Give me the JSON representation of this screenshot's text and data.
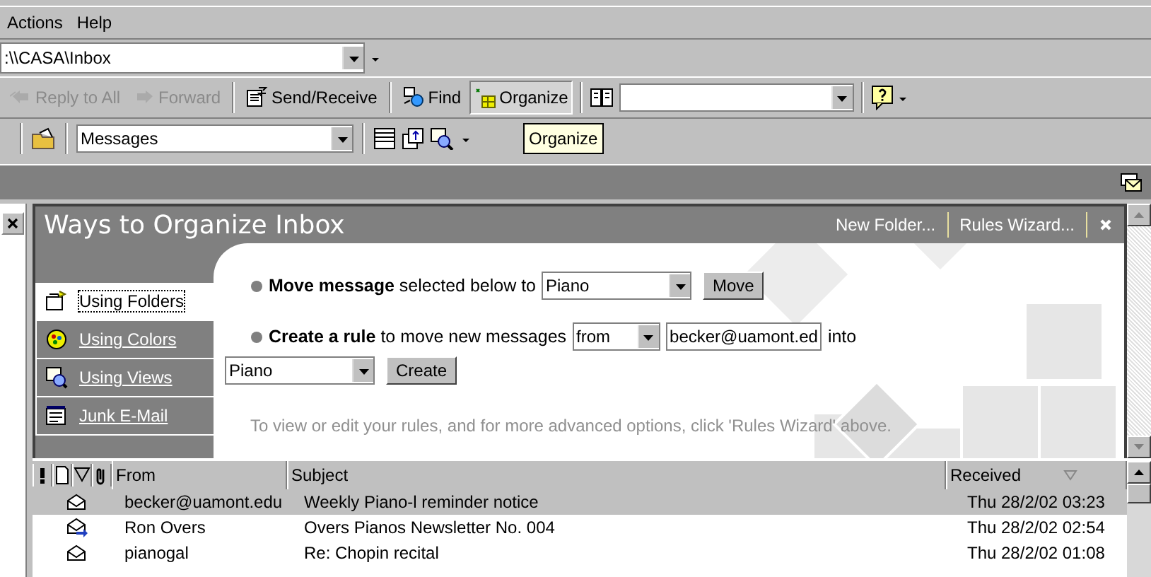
{
  "menu": [
    {
      "label": "Actions"
    },
    {
      "label": "Help"
    }
  ],
  "address": {
    "value": ":\\\\CASA\\Inbox"
  },
  "toolbar": [
    {
      "kind": "reply-all",
      "label": "Reply to All",
      "disabled": true,
      "pressed": false
    },
    {
      "kind": "forward",
      "label": "Forward",
      "disabled": true,
      "pressed": false
    },
    {
      "kind": "send-receive",
      "label": "Send/Receive",
      "disabled": false,
      "pressed": false
    },
    {
      "kind": "find",
      "label": "Find",
      "disabled": false,
      "pressed": false
    },
    {
      "kind": "organize",
      "label": "Organize",
      "disabled": false,
      "pressed": true
    }
  ],
  "view_combo": {
    "value": "Messages"
  },
  "tooltip": "Organize",
  "organize": {
    "title": "Ways to Organize Inbox",
    "links": [
      "New Folder...",
      "Rules Wizard..."
    ],
    "tabs": [
      {
        "kind": "folders",
        "label": "Using Folders",
        "selected": true
      },
      {
        "kind": "colors",
        "label": "Using Colors",
        "selected": false
      },
      {
        "kind": "views",
        "label": "Using Views",
        "selected": false
      },
      {
        "kind": "junk",
        "label": "Junk E-Mail",
        "selected": false
      }
    ],
    "move": {
      "text": "**Move message** selected below to",
      "folder": "Piano",
      "button": "Move"
    },
    "rule": {
      "text": "**Create a rule** to move new messages",
      "condition": "from",
      "address": "becker@uamont.ed",
      "into": "into",
      "folder": "Piano",
      "button": "Create"
    },
    "hint": "To view or edit your rules, and for more advanced options, click 'Rules Wizard' above."
  },
  "messages": {
    "columns": [
      "From",
      "Subject",
      "Received"
    ],
    "rows": [
      {
        "kind": "read",
        "from": "becker@uamont.edu",
        "subject": "Weekly Piano-l reminder notice",
        "received": "Thu 28/2/02 03:23",
        "selected": true
      },
      {
        "kind": "forwarded",
        "from": "Ron Overs",
        "subject": "Overs Pianos Newsletter No. 004",
        "received": "Thu 28/2/02 02:54",
        "selected": false
      },
      {
        "kind": "read",
        "from": "pianogal",
        "subject": "Re: Chopin recital",
        "received": "Thu 28/2/02 01:08",
        "selected": false
      }
    ]
  }
}
